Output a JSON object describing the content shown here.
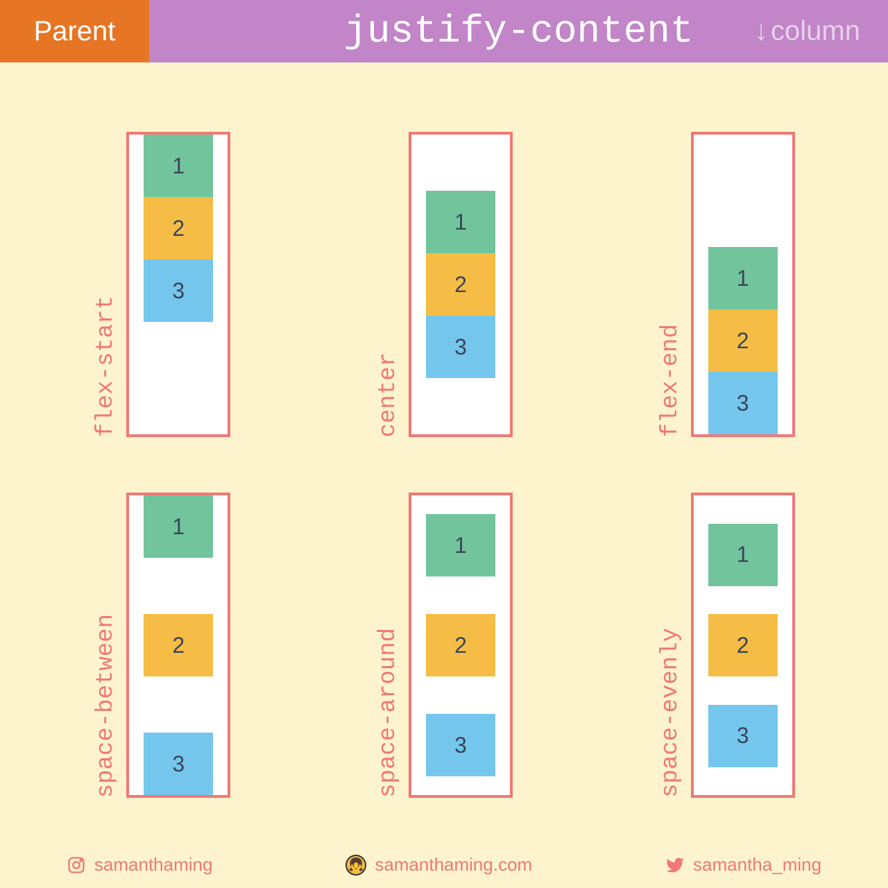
{
  "header": {
    "parent_label": "Parent",
    "title": "justify-content",
    "direction_label": "column",
    "arrow": "↓"
  },
  "demos": {
    "d1": {
      "label": "flex-start",
      "items": [
        "1",
        "2",
        "3"
      ]
    },
    "d2": {
      "label": "center",
      "items": [
        "1",
        "2",
        "3"
      ]
    },
    "d3": {
      "label": "flex-end",
      "items": [
        "1",
        "2",
        "3"
      ]
    },
    "d4": {
      "label": "space-between",
      "items": [
        "1",
        "2",
        "3"
      ]
    },
    "d5": {
      "label": "space-around",
      "items": [
        "1",
        "2",
        "3"
      ]
    },
    "d6": {
      "label": "space-evenly",
      "items": [
        "1",
        "2",
        "3"
      ]
    }
  },
  "footer": {
    "instagram": "samanthaming",
    "website": "samanthaming.com",
    "twitter": "samantha_ming"
  },
  "colors": {
    "bg": "#fdf4ce",
    "orange": "#e67524",
    "purple": "#c185c8",
    "salmon": "#f07875",
    "green": "#72c49c",
    "yellow": "#f5bd45",
    "blue": "#75c6ed"
  }
}
